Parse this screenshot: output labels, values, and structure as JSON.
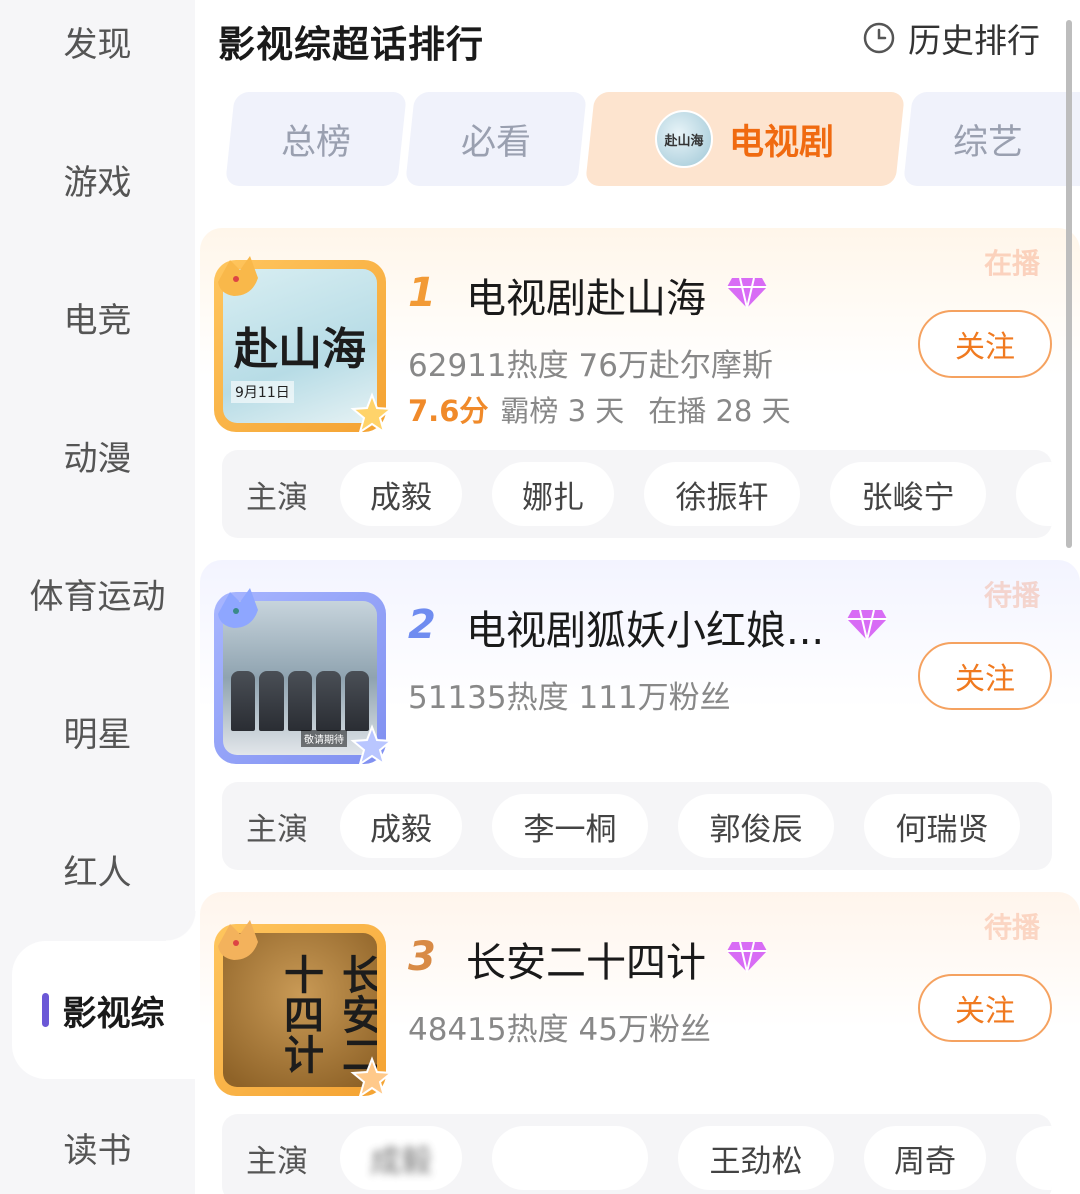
{
  "sidebar": {
    "items": [
      {
        "label": "发现"
      },
      {
        "label": "游戏"
      },
      {
        "label": "电竞"
      },
      {
        "label": "动漫"
      },
      {
        "label": "体育运动"
      },
      {
        "label": "明星"
      },
      {
        "label": "红人"
      },
      {
        "label": "影视综",
        "active": true
      },
      {
        "label": "读书"
      }
    ]
  },
  "header": {
    "title": "影视综超话排行",
    "history_label": "历史排行",
    "history_icon": "clock-icon"
  },
  "tabs": [
    {
      "label": "总榜"
    },
    {
      "label": "必看"
    },
    {
      "label": "电视剧",
      "active": true,
      "logo_text": "赴山海"
    },
    {
      "label": "综艺"
    }
  ],
  "ranking": [
    {
      "rank": "1",
      "title": "电视剧赴山海",
      "status": "在播",
      "stats": "62911热度 76万赴尔摩斯",
      "score": "7.6分",
      "top_days": "霸榜 3 天",
      "airing_days": "在播 28 天",
      "poster_text": "赴山海",
      "poster_date": "9月11日",
      "follow_label": "关注",
      "cast_label": "主演",
      "cast": [
        "成毅",
        "娜扎",
        "徐振轩",
        "张峻宁",
        "…"
      ]
    },
    {
      "rank": "2",
      "title": "电视剧狐妖小红娘...",
      "status": "待播",
      "stats": "51135热度 111万粉丝",
      "poster_badge": "敬请期待",
      "follow_label": "关注",
      "cast_label": "主演",
      "cast": [
        "成毅",
        "李一桐",
        "郭俊辰",
        "何瑞贤"
      ]
    },
    {
      "rank": "3",
      "title": "长安二十四计",
      "status": "待播",
      "stats": "48415热度 45万粉丝",
      "poster_text": "长安二十四计",
      "follow_label": "关注",
      "cast_label": "主演",
      "cast": [
        "成毅",
        "",
        "王劲松",
        "周奇",
        "…"
      ]
    }
  ],
  "colors": {
    "accent_orange": "#f07a20",
    "sidebar_bg": "#f6f6f8",
    "active_indicator": "#6b58d6",
    "rank1": "#f29a35",
    "rank2": "#6f8cf0",
    "rank3": "#d88a45"
  }
}
